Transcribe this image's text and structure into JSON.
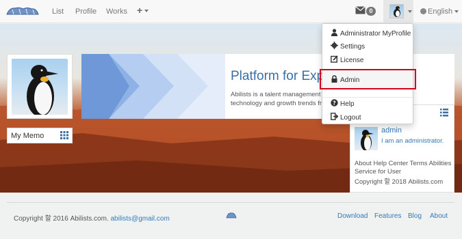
{
  "navbar": {
    "items": [
      "List",
      "Profile",
      "Works"
    ],
    "plus_label": "+",
    "message_count": "0",
    "language": "English"
  },
  "dropdown": {
    "my_profile": "Administrator MyProfile",
    "settings": "Settings",
    "license": "License",
    "admin": "Admin",
    "help": "Help",
    "logout": "Logout"
  },
  "hero": {
    "memo_label": "My Memo",
    "banner_title": "Platform for Exp",
    "banner_text_1": "Abilists is a talent management s",
    "banner_text_2": "technology and growth trends fro"
  },
  "right_panel": {
    "name": "admin",
    "description": "I am an administrator.",
    "links_line_1": "About Help Center Terms Abilities",
    "links_line_2": "Service for User",
    "copyright": "Copyright 할 2018 Abilists.com"
  },
  "footer": {
    "copyright": "Copyright 할 2016 Abilists.com.",
    "email": "abilists@gmail.com",
    "links": [
      "Download",
      "Features",
      "Blog",
      "About"
    ]
  },
  "colors": {
    "accent": "#337ab7",
    "title_blue": "#3a6ea5",
    "highlight": "#d0021b"
  }
}
